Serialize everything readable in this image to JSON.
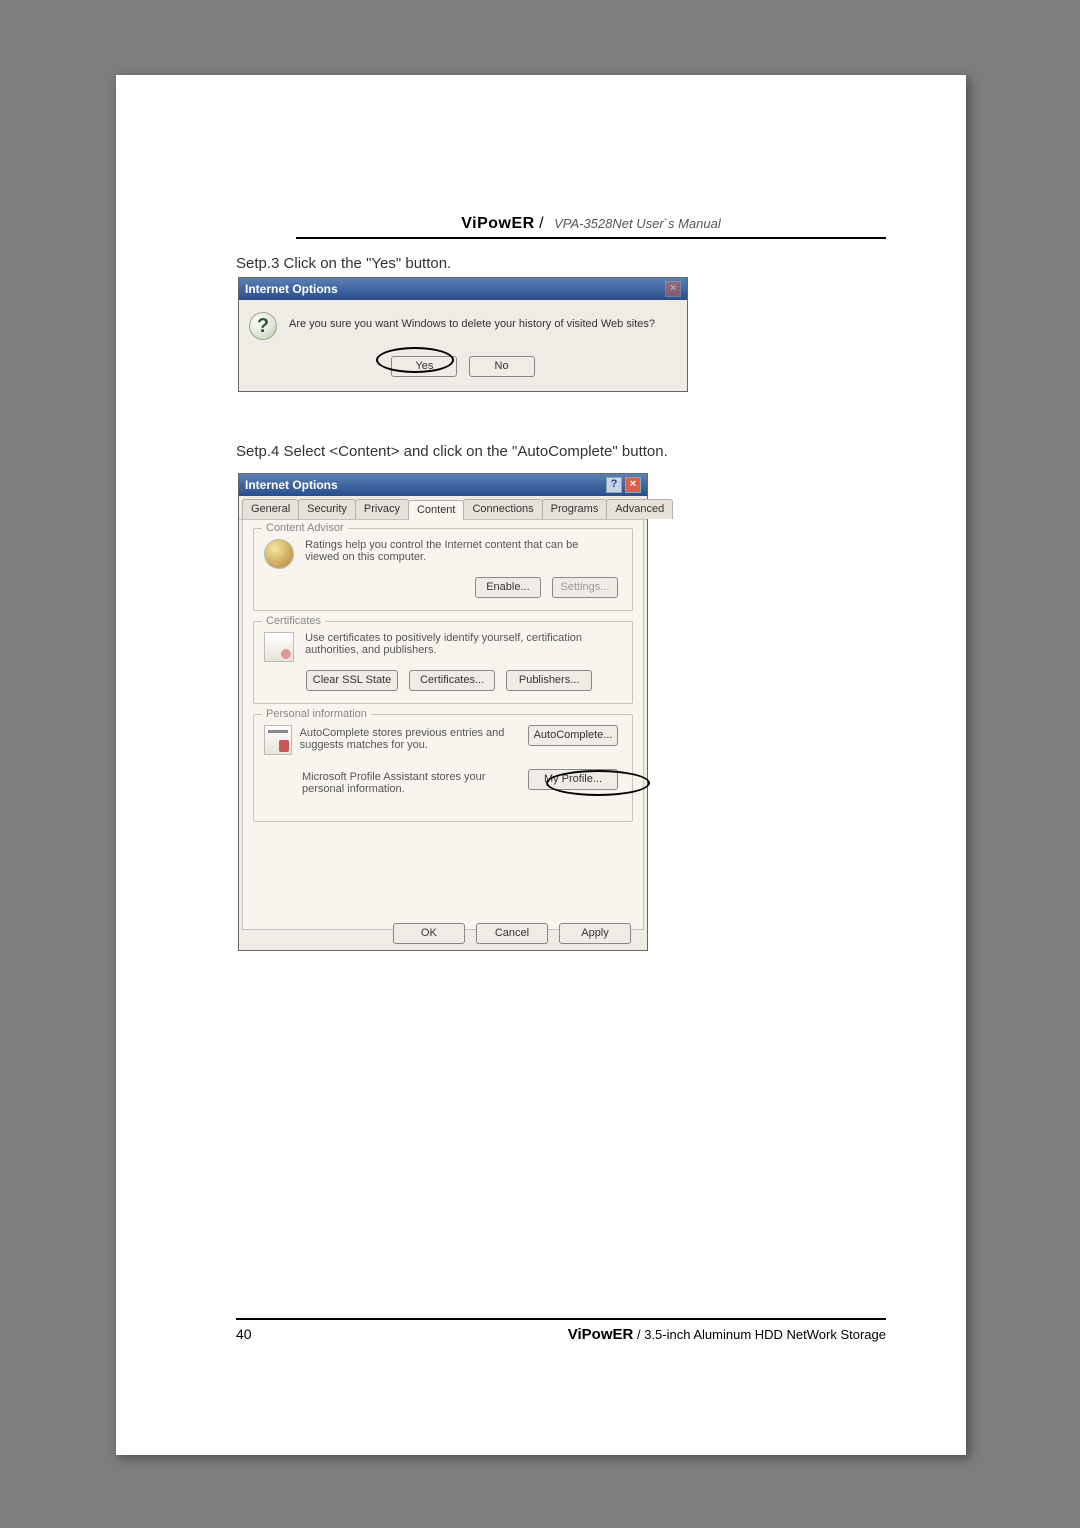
{
  "page_number": "40",
  "header": {
    "brand": "ViPowER",
    "sep": "  /  ",
    "model": "VPA-3528Net User`s Manual"
  },
  "step3_text": "Setp.3 Click on the \"Yes\" button.",
  "step4_text": "Setp.4 Select <Content> and click on the \"AutoComplete\" button.",
  "dlg1": {
    "title": "Internet Options",
    "message": "Are you sure you want Windows to delete your history of visited Web sites?",
    "yes": "Yes",
    "no": "No"
  },
  "dlg2": {
    "title": "Internet Options",
    "tabs": [
      "General",
      "Security",
      "Privacy",
      "Content",
      "Connections",
      "Programs",
      "Advanced"
    ],
    "active_tab_index": 3,
    "content_advisor": {
      "legend": "Content Advisor",
      "desc": "Ratings help you control the Internet content that can be viewed on this computer.",
      "enable": "Enable...",
      "settings": "Settings..."
    },
    "certificates": {
      "legend": "Certificates",
      "desc": "Use certificates to positively identify yourself, certification authorities, and publishers.",
      "clear": "Clear SSL State",
      "certs": "Certificates...",
      "pubs": "Publishers..."
    },
    "personal": {
      "legend": "Personal information",
      "auto_desc": "AutoComplete stores previous entries and suggests matches for you.",
      "auto_btn": "AutoComplete...",
      "profile_desc": "Microsoft Profile Assistant stores your personal information.",
      "profile_btn": "My Profile..."
    },
    "bottom": {
      "ok": "OK",
      "cancel": "Cancel",
      "apply": "Apply"
    }
  },
  "footer": {
    "brand": "ViPowER",
    "sep": "  /  ",
    "product": "3.5-inch Aluminum HDD NetWork Storage"
  }
}
